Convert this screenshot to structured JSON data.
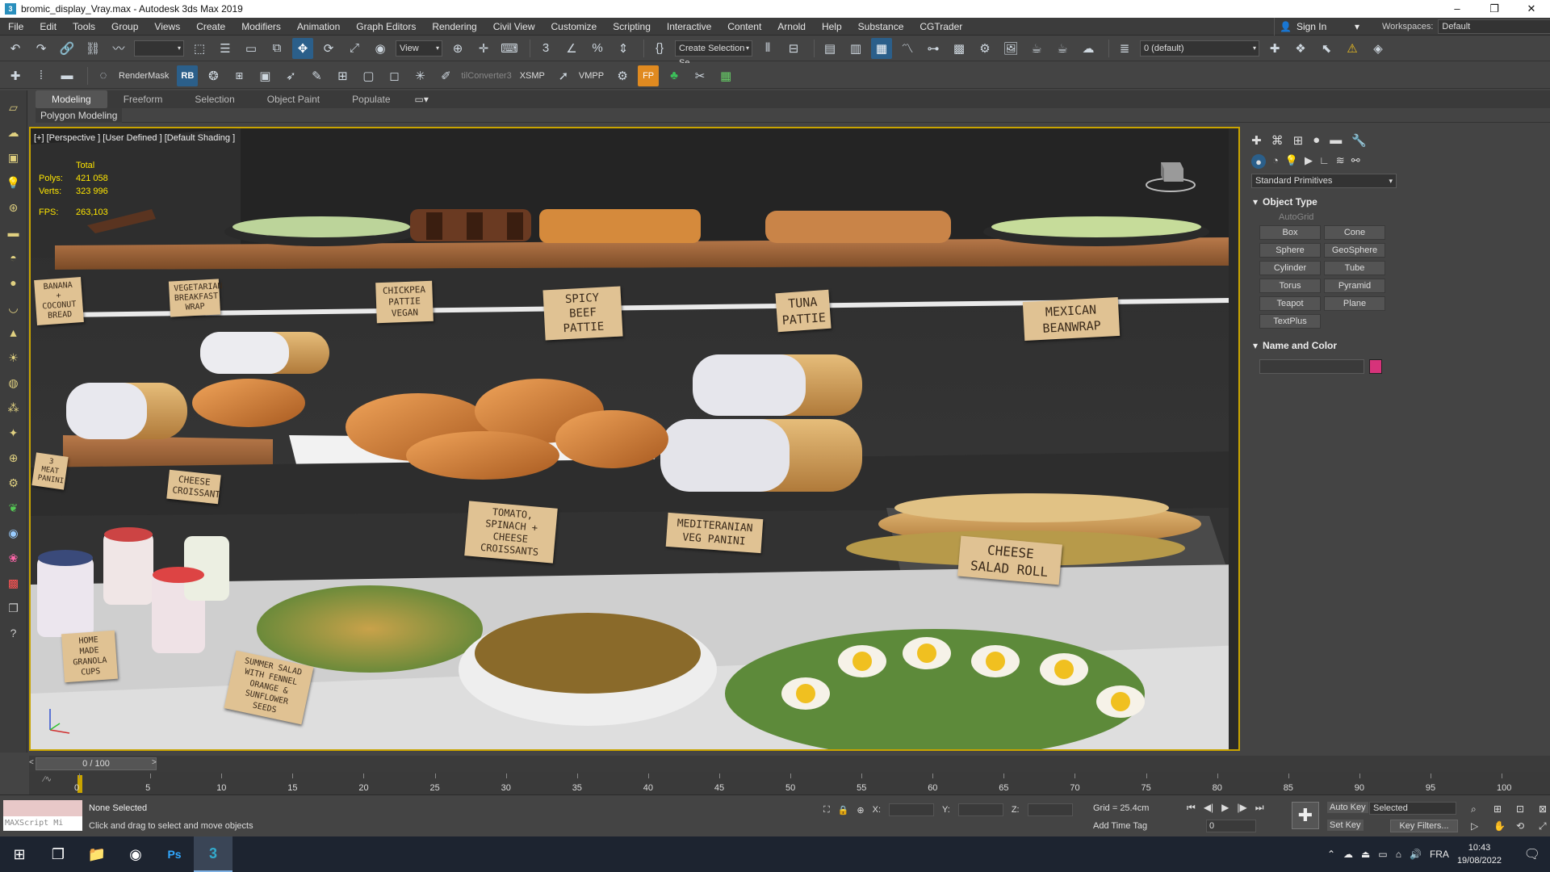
{
  "window": {
    "title": "bromic_display_Vray.max - Autodesk 3ds Max 2019",
    "controls": [
      "–",
      "❐",
      "✕"
    ]
  },
  "menu": [
    "File",
    "Edit",
    "Tools",
    "Group",
    "Views",
    "Create",
    "Modifiers",
    "Animation",
    "Graph Editors",
    "Rendering",
    "Civil View",
    "Customize",
    "Scripting",
    "Interactive",
    "Content",
    "Arnold",
    "Help",
    "Substance",
    "CGTrader"
  ],
  "account": {
    "sign_in": "Sign In",
    "workspaces_label": "Workspaces:",
    "workspace": "Default"
  },
  "toolbar1": {
    "view_dropdown": "View",
    "selection_set": "Create Selection Se",
    "layer": "0 (default)"
  },
  "toolbar2": {
    "rendermask": "RenderMask",
    "rb": "RB",
    "converter": "tilConverter3",
    "xsmp": "XSMP",
    "vmpp": "VMPP"
  },
  "ribbon": {
    "tabs": [
      "Modeling",
      "Freeform",
      "Selection",
      "Object Paint",
      "Populate"
    ],
    "sub": "Polygon Modeling"
  },
  "viewport": {
    "label": "[+] [Perspective ] [User Defined ] [Default Shading ]",
    "stats": {
      "total": "Total",
      "polys_label": "Polys:",
      "polys": "421 058",
      "verts_label": "Verts:",
      "verts": "323 996",
      "fps_label": "FPS:",
      "fps": "263,103"
    },
    "signs": {
      "s1": "BANANA + COCONUT BREAD",
      "s2": "VEGETARIAN BREAKFAST WRAP",
      "s3": "CHICKPEA PATTIE VEGAN",
      "s4": "SPICY BEEF PATTIE",
      "s5": "TUNA PATTIE",
      "s6": "MEXICAN BEANWRAP",
      "s7": "3 MEAT PANINI",
      "s8": "CHEESE CROISSANT",
      "s9": "TOMATO, SPINACH + CHEESE CROISSANTS",
      "s10": "MEDITERANIAN VEG PANINI",
      "s11": "CHEESE SALAD ROLL",
      "s12": "HOME MADE GRANOLA CUPS",
      "s13": "SUMMER SALAD WITH FENNEL ORANGE & SUNFLOWER SEEDS"
    }
  },
  "command_panel": {
    "dropdown": "Standard Primitives",
    "object_type": "Object Type",
    "autogrid": "AutoGrid",
    "primitives": [
      "Box",
      "Cone",
      "Sphere",
      "GeoSphere",
      "Cylinder",
      "Tube",
      "Torus",
      "Pyramid",
      "Teapot",
      "Plane",
      "TextPlus"
    ],
    "name_and_color": "Name and Color",
    "color": "#d6337a"
  },
  "timeline": {
    "frame": "0 / 100",
    "ticks": [
      "0",
      "5",
      "10",
      "15",
      "20",
      "25",
      "30",
      "35",
      "40",
      "45",
      "50",
      "55",
      "60",
      "65",
      "70",
      "75",
      "80",
      "85",
      "90",
      "95",
      "100"
    ]
  },
  "status": {
    "maxscript": "MAXScript Mi",
    "selection": "None Selected",
    "prompt": "Click and drag to select and move objects",
    "x": "X:",
    "y": "Y:",
    "z": "Z:",
    "grid": "Grid = 25.4cm",
    "add_time_tag": "Add Time Tag",
    "frame_value": "0",
    "auto_key": "Auto Key",
    "set_key": "Set Key",
    "selected": "Selected",
    "key_filters": "Key Filters..."
  },
  "taskbar": {
    "lang": "FRA",
    "time": "10:43",
    "date": "19/08/2022"
  }
}
